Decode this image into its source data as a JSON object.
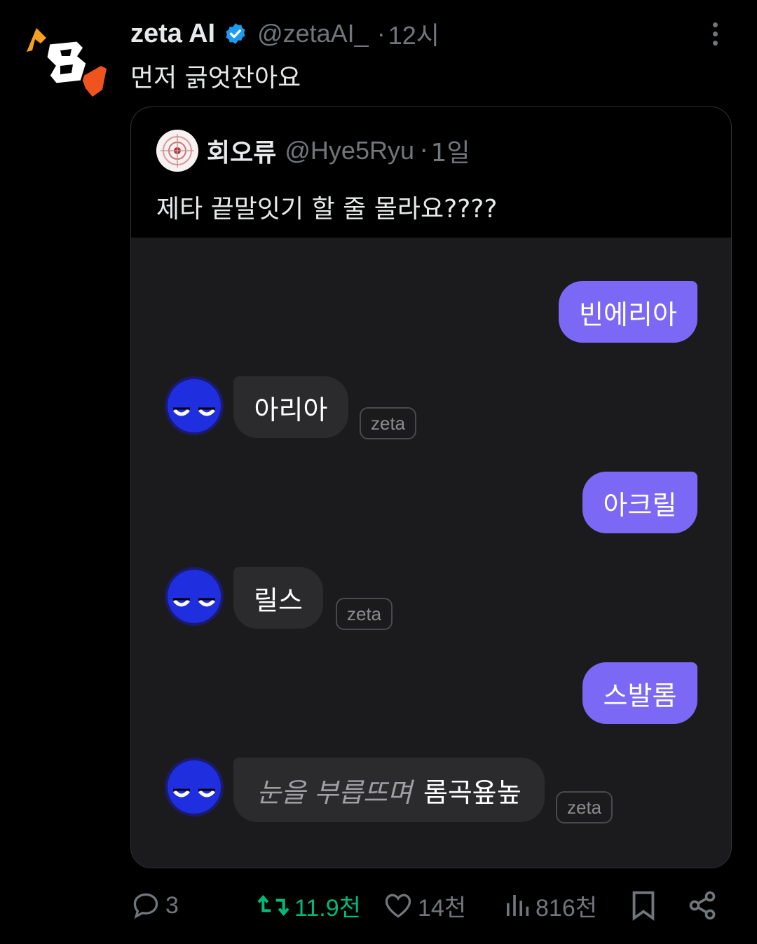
{
  "tweet": {
    "display_name": "zeta AI",
    "handle": "@zetaAI_",
    "separator": "·",
    "time": "12시",
    "text": "먼저 긁엇잔아요"
  },
  "quote": {
    "display_name": "회오류",
    "handle": "@Hye5Ryu",
    "separator": "·",
    "time": "1일",
    "text": "제타 끝말잇기 할 줄 몰라요????"
  },
  "chat": {
    "messages": [
      {
        "role": "user",
        "text": "빈에리아"
      },
      {
        "role": "bot",
        "text": "아리아",
        "tag": "zeta"
      },
      {
        "role": "user",
        "text": "아크릴"
      },
      {
        "role": "bot",
        "text": "릴스",
        "tag": "zeta"
      },
      {
        "role": "user",
        "text": "스발롬"
      },
      {
        "role": "bot",
        "italic": "눈을 부릅뜨며",
        "text": "롬곡욮높",
        "tag": "zeta"
      }
    ]
  },
  "actions": {
    "reply_count": "3",
    "retweet_count": "11.9천",
    "like_count": "14천",
    "view_count": "816천"
  },
  "colors": {
    "user_bubble": "#7b68f5",
    "retweet": "#00ba7c",
    "verified": "#1d9bf0",
    "muted": "#71767b"
  },
  "icons": [
    "logo-icon",
    "verified-icon",
    "more-icon",
    "reply-icon",
    "retweet-icon",
    "like-icon",
    "views-icon",
    "bookmark-icon",
    "share-icon"
  ]
}
